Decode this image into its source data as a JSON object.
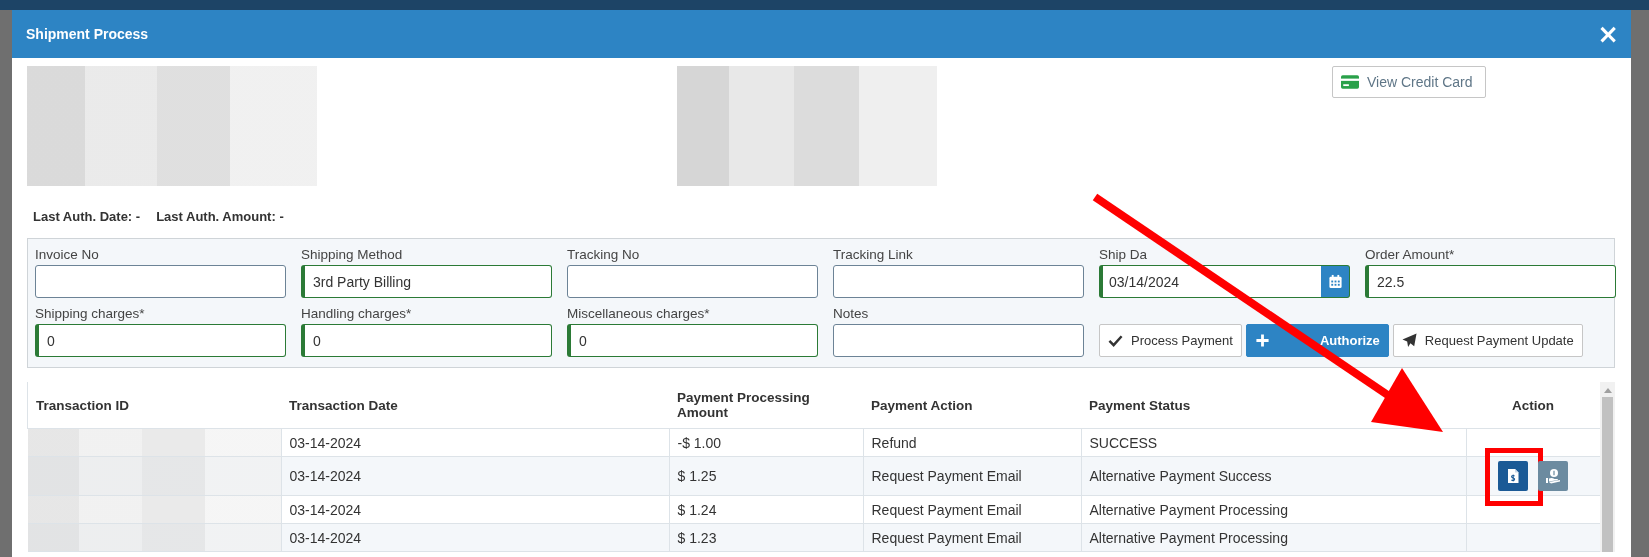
{
  "window": {
    "title": "Shipment Process",
    "close": "×"
  },
  "header_button": {
    "label": "View Credit Card"
  },
  "auth_info": [
    {
      "label": "Last Auth. Date:",
      "value": "-"
    },
    {
      "label": "Last Auth. Amount:",
      "value": "-"
    }
  ],
  "fields": [
    {
      "kind": "text",
      "label": "Invoice No",
      "validated": false
    },
    {
      "kind": "text",
      "label": "Shipping Method",
      "value": "3rd Party Billing",
      "validated": true
    },
    {
      "kind": "text",
      "label": "Tracking No",
      "validated": false
    },
    {
      "kind": "text",
      "label": "Tracking Link",
      "validated": false
    },
    {
      "kind": "date",
      "label": "Ship Da",
      "value": "03/14/2024",
      "validated": true
    },
    {
      "kind": "text",
      "label": "Order Amount*",
      "value": "22.5",
      "validated": true
    },
    {
      "kind": "text",
      "label": "Shipping charges*",
      "value": "0",
      "validated": true
    },
    {
      "kind": "text",
      "label": "Handling charges*",
      "value": "0",
      "validated": true
    },
    {
      "kind": "text",
      "label": "Miscellaneous charges*",
      "value": "0",
      "validated": true
    },
    {
      "kind": "text",
      "label": "Notes",
      "validated": false
    }
  ],
  "actions": [
    {
      "kind": "check",
      "label": "Process Payment",
      "primary": false
    },
    {
      "kind": "plus",
      "label": "Authorize",
      "primary": true
    },
    {
      "kind": "send",
      "label": "Request Payment Update",
      "primary": false
    }
  ],
  "table": {
    "columns": [
      "Transaction ID",
      "Transaction Date",
      "Payment Processing Amount",
      "Payment Action",
      "Payment Status",
      "Action"
    ],
    "rows": [
      {
        "date": "03-14-2024",
        "amount": "-$ 1.00",
        "action": "Refund",
        "status": "SUCCESS"
      },
      {
        "date": "03-14-2024",
        "amount": "$ 1.25",
        "action": "Request Payment Email",
        "status": "Alternative Payment Success",
        "buttons": [
          {
            "kind": "invoice",
            "highlighted": true
          },
          {
            "kind": "payment",
            "highlighted": false
          }
        ]
      },
      {
        "date": "03-14-2024",
        "amount": "$ 1.24",
        "action": "Request Payment Email",
        "status": "Alternative Payment Processing"
      },
      {
        "date": "03-14-2024",
        "amount": "$ 1.23",
        "action": "Request Payment Email",
        "status": "Alternative Payment Processing"
      }
    ]
  },
  "annotations": [
    {
      "kind": "arrow"
    }
  ]
}
